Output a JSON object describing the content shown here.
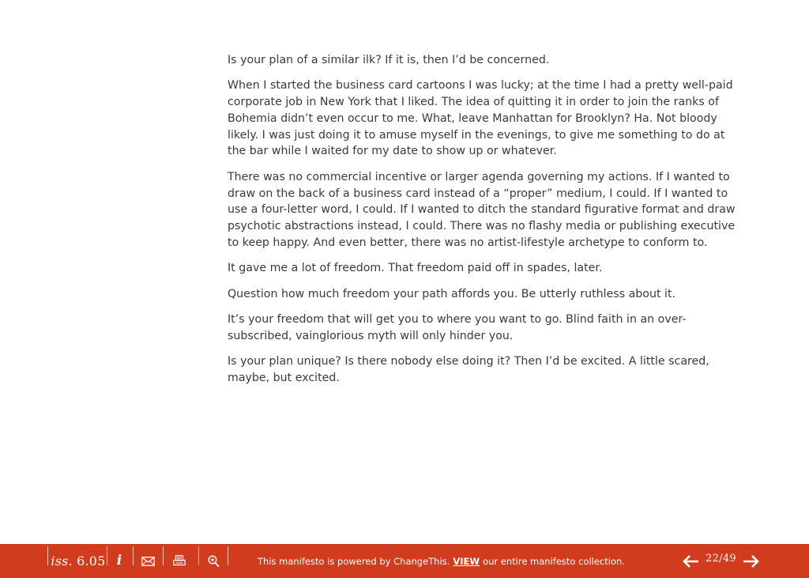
{
  "body": {
    "paragraphs": [
      "Is your plan of a similar ilk? If it is, then I’d be concerned.",
      "When I started the business card cartoons I was lucky; at the time I had a pretty well-paid corporate job in New York that I liked. The idea of quitting it in order to join the ranks of Bohemia didn’t even occur to me. What, leave Manhattan for Brooklyn? Ha. Not bloody likely. I was just doing it to amuse myself in the evenings, to give me something to do at the bar while I waited for my date to show up or whatever.",
      "There was no commercial incentive or larger agenda governing my actions. If I wanted to draw on the back of a business card instead of a “proper” medium, I could. If I wanted to use a four-letter word, I could. If I wanted to ditch the standard figurative format and draw psychotic abstractions instead, I could. There was no flashy media or publishing executive to keep happy. And even better, there was no artist-lifestyle archetype to conform to.",
      "It gave me a lot of freedom. That freedom paid off in spades, later.",
      "Question how much freedom your path affords you. Be utterly ruthless about it.",
      "It’s your freedom that will get you to where you want to go. Blind faith in an over-subscribed, vainglorious myth will only hinder you.",
      "Is your plan unique? Is there nobody else doing it? Then I’d be excited. A little scared, maybe, but excited."
    ]
  },
  "footer": {
    "issue_prefix": "iss.",
    "issue_number": "6.05",
    "info_label": "i",
    "tagline_before": "This manifesto is powered by ChangeThis.",
    "view_link": "VIEW",
    "tagline_after": "our entire manifesto collection.",
    "page_indicator": "22/49",
    "icons": {
      "info": "info-icon",
      "email": "envelope-icon",
      "print": "printer-icon",
      "zoom": "magnifier-icon",
      "prev": "arrow-left-icon",
      "next": "arrow-right-icon"
    },
    "colors": {
      "bar": "#d23c1e",
      "text": "#ffffff",
      "body_text": "#3a3a3a"
    }
  }
}
